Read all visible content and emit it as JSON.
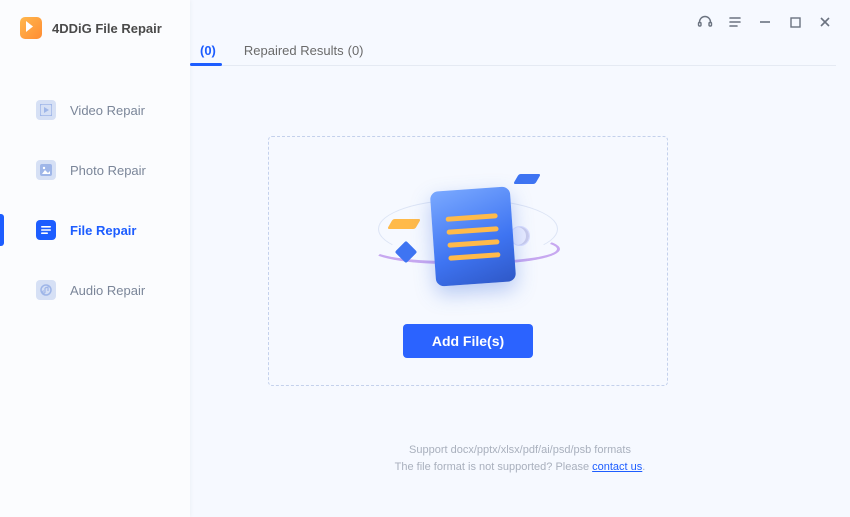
{
  "app": {
    "name": "4DDiG File Repair"
  },
  "sidebar": {
    "items": [
      {
        "label": "Video Repair"
      },
      {
        "label": "Photo Repair"
      },
      {
        "label": "File Repair"
      },
      {
        "label": "Audio Repair"
      }
    ],
    "active_index": 2
  },
  "tabs": {
    "unrepaired": {
      "label_hidden_prefix": "",
      "count": "(0)"
    },
    "repaired": {
      "label": "Repaired Results",
      "count": "(0)"
    },
    "active_index": 0
  },
  "dropzone": {
    "add_button": "Add File(s)"
  },
  "footer": {
    "line1": "Support docx/pptx/xlsx/pdf/ai/psd/psb formats",
    "line2_prefix": "The file format is not supported? Please ",
    "contact_link": "contact us",
    "line2_suffix": "."
  }
}
